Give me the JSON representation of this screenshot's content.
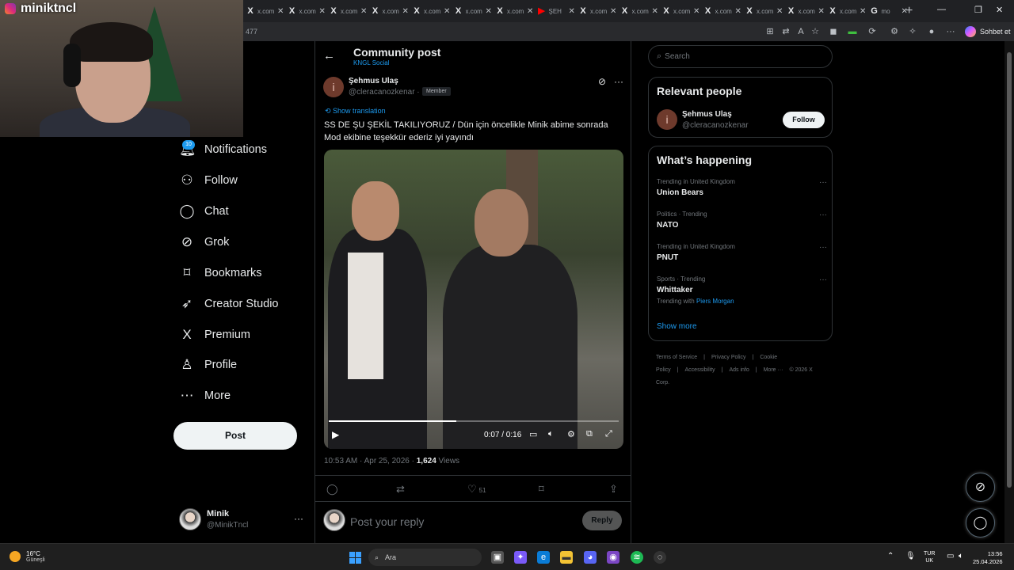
{
  "browser": {
    "tabs": [
      {
        "icon": "x-logo-icon",
        "label": "x.com"
      },
      {
        "icon": "x-logo-icon",
        "label": "x.com"
      },
      {
        "icon": "x-logo-icon",
        "label": "x.com"
      },
      {
        "icon": "x-logo-icon",
        "label": "x.com"
      },
      {
        "icon": "x-logo-icon",
        "label": "x.com"
      },
      {
        "icon": "x-logo-icon",
        "label": "x.com"
      },
      {
        "icon": "x-logo-icon",
        "label": "x.com"
      },
      {
        "icon": "youtube-icon",
        "label": "ŞEH"
      },
      {
        "icon": "x-logo-icon",
        "label": "x.com"
      },
      {
        "icon": "x-logo-icon",
        "label": "x.com"
      },
      {
        "icon": "x-logo-icon",
        "label": "x.com"
      },
      {
        "icon": "x-logo-icon",
        "label": "x.com"
      },
      {
        "icon": "x-logo-icon",
        "label": "x.com"
      },
      {
        "icon": "x-logo-icon",
        "label": "x.com"
      },
      {
        "icon": "x-logo-icon",
        "label": "x.com"
      },
      {
        "icon": "google-icon",
        "label": "mo"
      }
    ],
    "address_fragment": "477",
    "copilot_label": "Sohbet et"
  },
  "webcam": {
    "channel_name": "miniktncl"
  },
  "sidebar": {
    "notifications_badge": "10",
    "items": [
      {
        "label": "Notifications",
        "icon": "bell-icon"
      },
      {
        "label": "Follow",
        "icon": "person-plus-icon"
      },
      {
        "label": "Chat",
        "icon": "chat-bubble-icon"
      },
      {
        "label": "Grok",
        "icon": "grok-icon"
      },
      {
        "label": "Bookmarks",
        "icon": "bookmark-icon"
      },
      {
        "label": "Creator Studio",
        "icon": "rocket-icon"
      },
      {
        "label": "Premium",
        "icon": "x-logo-icon"
      },
      {
        "label": "Profile",
        "icon": "person-icon"
      },
      {
        "label": "More",
        "icon": "more-circle-icon"
      }
    ],
    "post_button": "Post",
    "account": {
      "name": "Minik",
      "handle": "@MinikTncl"
    }
  },
  "post": {
    "header_title": "Community post",
    "header_subtitle": "KNGL Social",
    "author_initial": "i",
    "author_name": "Şehmus Ulaş",
    "author_handle": "@cleracanozkenar ·",
    "author_badge": "Member",
    "show_translation": "Show translation",
    "text": "SS DE ŞU ŞEKİL TAKILIYORUZ / Dün için öncelikle Minik abime sonrada Mod ekibine teşekkür ederiz iyi yayındı",
    "video": {
      "time": "0:07 / 0:16",
      "progress": 0.44
    },
    "meta_time": "10:53 AM · Apr 25, 2026 · ",
    "views_count": "1,624",
    "views_label": " Views",
    "likes": "51",
    "reply_placeholder": "Post your reply",
    "reply_button": "Reply"
  },
  "right": {
    "search_placeholder": "Search",
    "relevant_title": "Relevant people",
    "relevant_person": {
      "initial": "i",
      "name": "Şehmus Ulaş",
      "handle": "@cleracanozkenar",
      "button": "Follow"
    },
    "happening_title": "What’s happening",
    "trends": [
      {
        "context": "Trending in United Kingdom",
        "title": "Union Bears"
      },
      {
        "context": "Politics · Trending",
        "title": "NATO"
      },
      {
        "context": "Trending in United Kingdom",
        "title": "PNUT"
      },
      {
        "context": "Sports · Trending",
        "title": "Whittaker",
        "with_label": "Trending with ",
        "with_name": "Piers Morgan"
      }
    ],
    "show_more": "Show more",
    "footer": [
      "Terms of Service",
      "|",
      "Privacy Policy",
      "|",
      "Cookie Policy",
      "|",
      "Accessibility",
      "|",
      "Ads info",
      "|",
      "More ···",
      "© 2026 X Corp."
    ]
  },
  "taskbar": {
    "weather_temp": "16°C",
    "weather_desc": "Güneşli",
    "search_label": "Ara",
    "lang_top": "TUR",
    "lang_bottom": "UK",
    "time": "13:56",
    "date": "25.04.2026"
  }
}
